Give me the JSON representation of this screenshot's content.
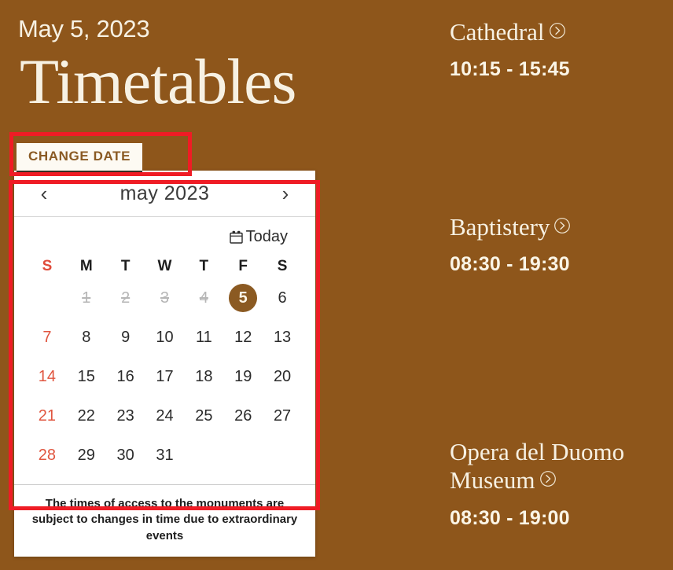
{
  "header": {
    "date_label": "May 5, 2023",
    "title": "Timetables",
    "change_date_label": "CHANGE DATE"
  },
  "calendar": {
    "prev_icon": "chevron-left-icon",
    "next_icon": "chevron-right-icon",
    "prev_label": "‹",
    "next_label": "›",
    "month_label": "may 2023",
    "today_label": "Today",
    "today_icon": "calendar-icon",
    "weekdays": [
      "S",
      "M",
      "T",
      "W",
      "T",
      "F",
      "S"
    ],
    "weeks": [
      [
        {
          "label": "",
          "state": "empty"
        },
        {
          "label": "1",
          "state": "disabled"
        },
        {
          "label": "2",
          "state": "disabled"
        },
        {
          "label": "3",
          "state": "disabled"
        },
        {
          "label": "4",
          "state": "disabled"
        },
        {
          "label": "5",
          "state": "selected"
        },
        {
          "label": "6",
          "state": "normal"
        }
      ],
      [
        {
          "label": "7",
          "state": "sunday"
        },
        {
          "label": "8",
          "state": "normal"
        },
        {
          "label": "9",
          "state": "normal"
        },
        {
          "label": "10",
          "state": "normal"
        },
        {
          "label": "11",
          "state": "normal"
        },
        {
          "label": "12",
          "state": "normal"
        },
        {
          "label": "13",
          "state": "normal"
        }
      ],
      [
        {
          "label": "14",
          "state": "sunday"
        },
        {
          "label": "15",
          "state": "normal"
        },
        {
          "label": "16",
          "state": "normal"
        },
        {
          "label": "17",
          "state": "normal"
        },
        {
          "label": "18",
          "state": "normal"
        },
        {
          "label": "19",
          "state": "normal"
        },
        {
          "label": "20",
          "state": "normal"
        }
      ],
      [
        {
          "label": "21",
          "state": "sunday"
        },
        {
          "label": "22",
          "state": "normal"
        },
        {
          "label": "23",
          "state": "normal"
        },
        {
          "label": "24",
          "state": "normal"
        },
        {
          "label": "25",
          "state": "normal"
        },
        {
          "label": "26",
          "state": "normal"
        },
        {
          "label": "27",
          "state": "normal"
        }
      ],
      [
        {
          "label": "28",
          "state": "sunday"
        },
        {
          "label": "29",
          "state": "normal"
        },
        {
          "label": "30",
          "state": "normal"
        },
        {
          "label": "31",
          "state": "normal"
        },
        {
          "label": "",
          "state": "empty"
        },
        {
          "label": "",
          "state": "empty"
        },
        {
          "label": "",
          "state": "empty"
        }
      ]
    ],
    "note": "The times of access to the monuments are subject to changes in time due to extraordinary events"
  },
  "monuments": [
    {
      "name": "Cathedral",
      "hours": "10:15 - 15:45",
      "link_icon": "circle-chevron-right-icon"
    },
    {
      "name": "Baptistery",
      "hours": "08:30 - 19:30",
      "link_icon": "circle-chevron-right-icon"
    },
    {
      "name": "Opera del Duomo Museum",
      "hours": "08:30 - 19:00",
      "link_icon": "circle-chevron-right-icon"
    }
  ],
  "colors": {
    "background": "#8e561b",
    "cream": "#f7f1e3",
    "selected_day": "#8b5a22",
    "sunday_red": "#e0553f",
    "annotation_red": "#ef1c25",
    "button_text": "#8a5a23"
  }
}
